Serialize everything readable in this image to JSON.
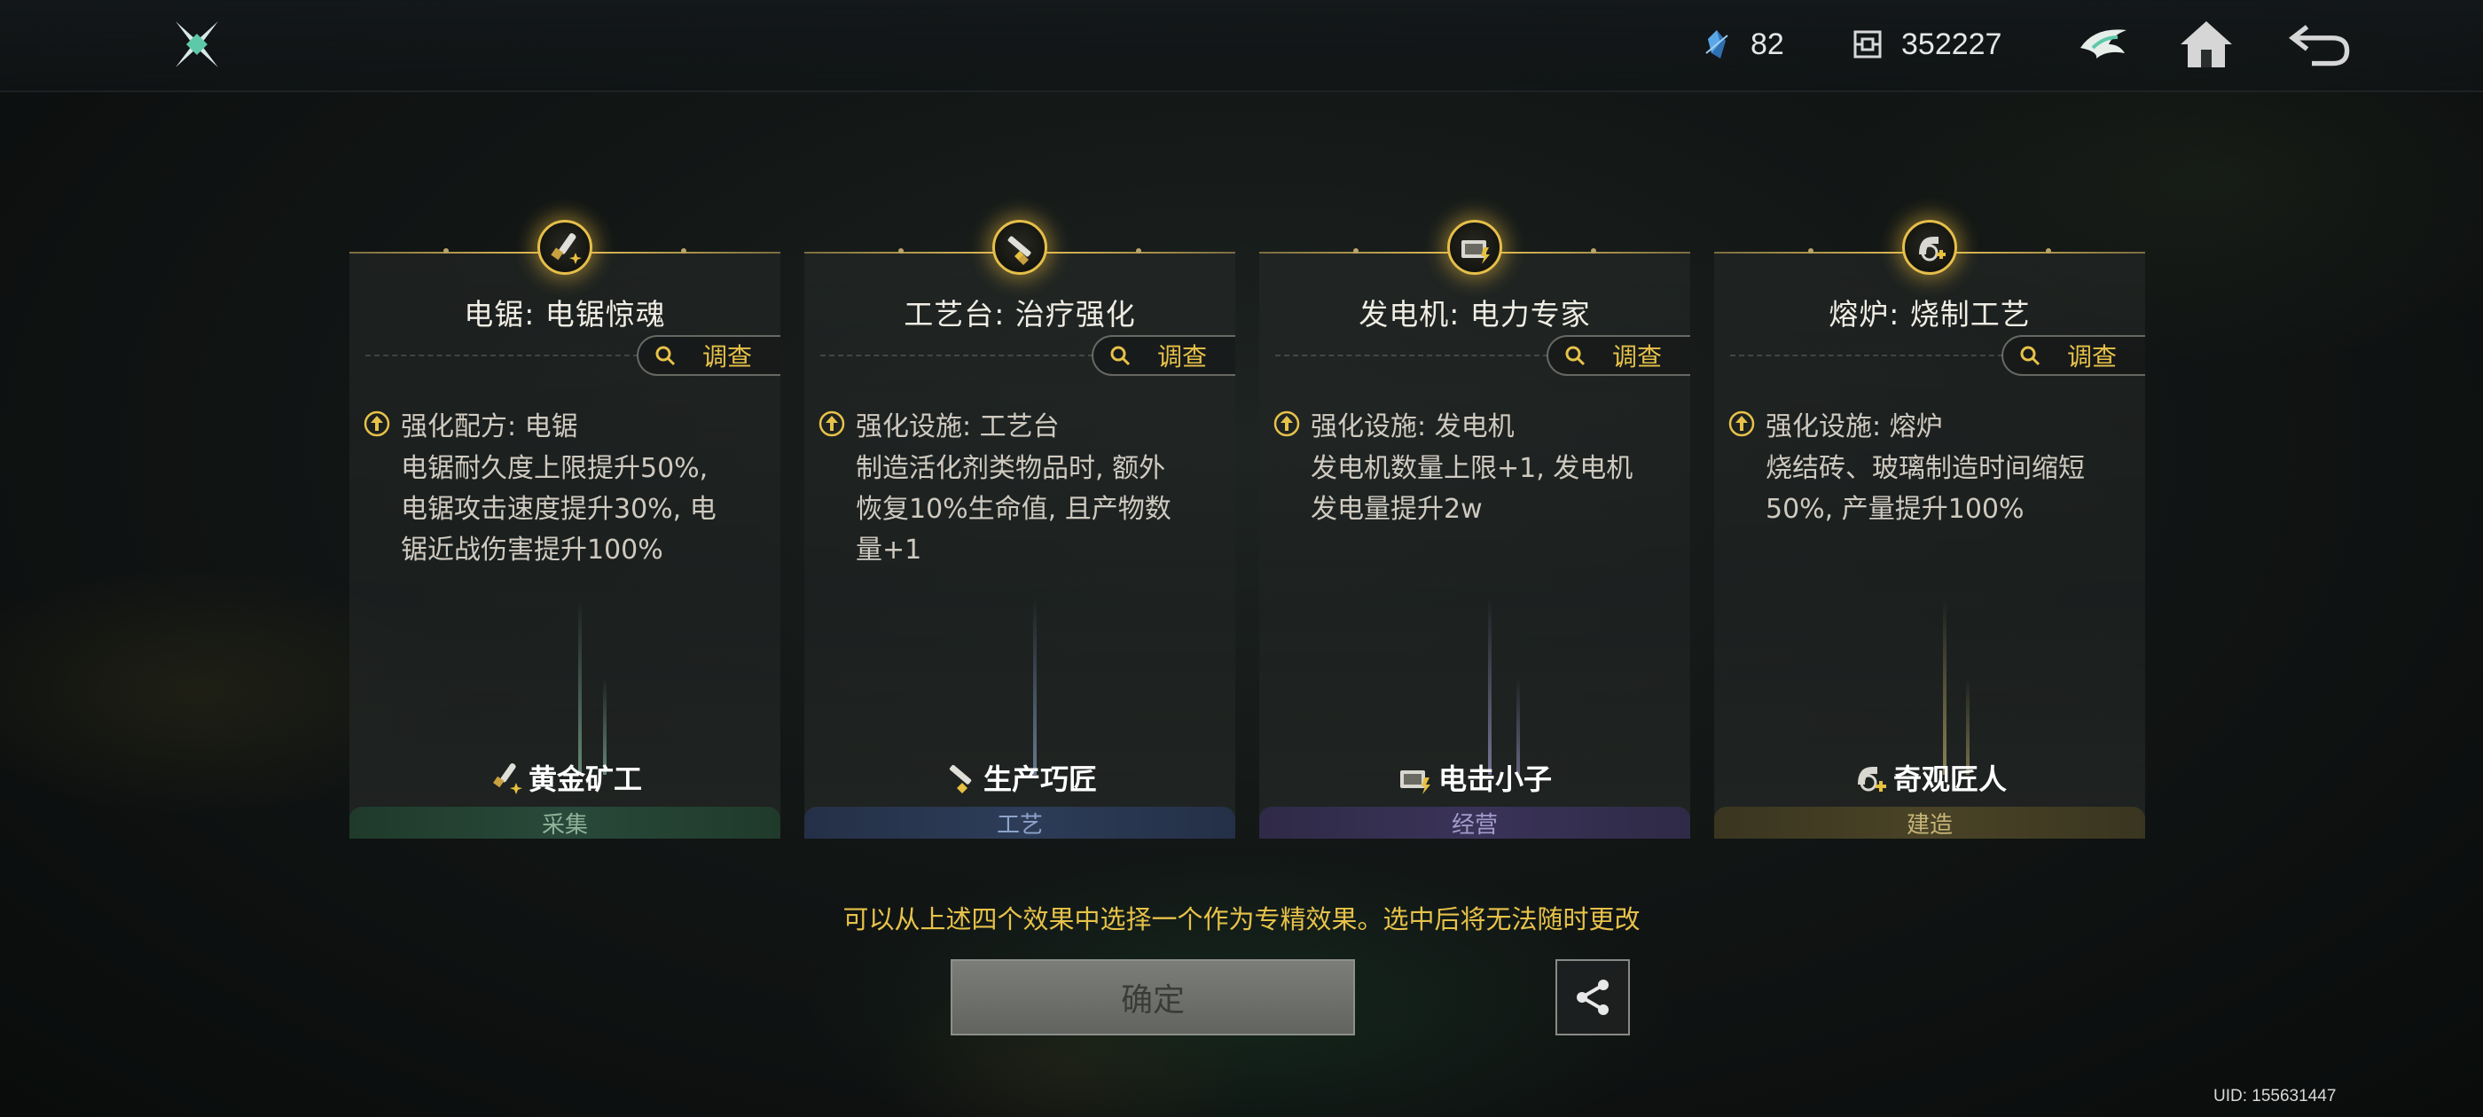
{
  "topbar": {
    "currency_a": {
      "icon": "energy-crystal-icon",
      "value": "82"
    },
    "currency_b": {
      "icon": "coin-icon",
      "value": "352227"
    }
  },
  "cards": [
    {
      "title": "电锯: 电锯惊魂",
      "investigate": "调查",
      "effect_head": "强化配方: 电锯",
      "effect_lines": [
        "电锯耐久度上限提升50%,",
        "电锯攻击速度提升30%, 电",
        "锯近战伤害提升100%"
      ],
      "badge": "黄金矿工",
      "category": "采集",
      "accent": "#5fa77a"
    },
    {
      "title": "工艺台: 治疗强化",
      "investigate": "调查",
      "effect_head": "强化设施: 工艺台",
      "effect_lines": [
        "制造活化剂类物品时, 额外",
        "恢复10%生命值, 且产物数",
        "量+1"
      ],
      "badge": "生产巧匠",
      "category": "工艺",
      "accent": "#6f8fc9"
    },
    {
      "title": "发电机: 电力专家",
      "investigate": "调查",
      "effect_head": "强化设施: 发电机",
      "effect_lines": [
        "发电机数量上限+1, 发电机",
        "发电量提升2w"
      ],
      "badge": "电击小子",
      "category": "经营",
      "accent": "#8e85c9"
    },
    {
      "title": "熔炉: 烧制工艺",
      "investigate": "调查",
      "effect_head": "强化设施: 熔炉",
      "effect_lines": [
        "烧结砖、玻璃制造时间缩短",
        "50%, 产量提升100%"
      ],
      "badge": "奇观匠人",
      "category": "建造",
      "accent": "#c6aa4e"
    }
  ],
  "hint": "可以从上述四个效果中选择一个作为专精效果。选中后将无法随时更改",
  "confirm_label": "确定",
  "uid": "UID: 155631447"
}
